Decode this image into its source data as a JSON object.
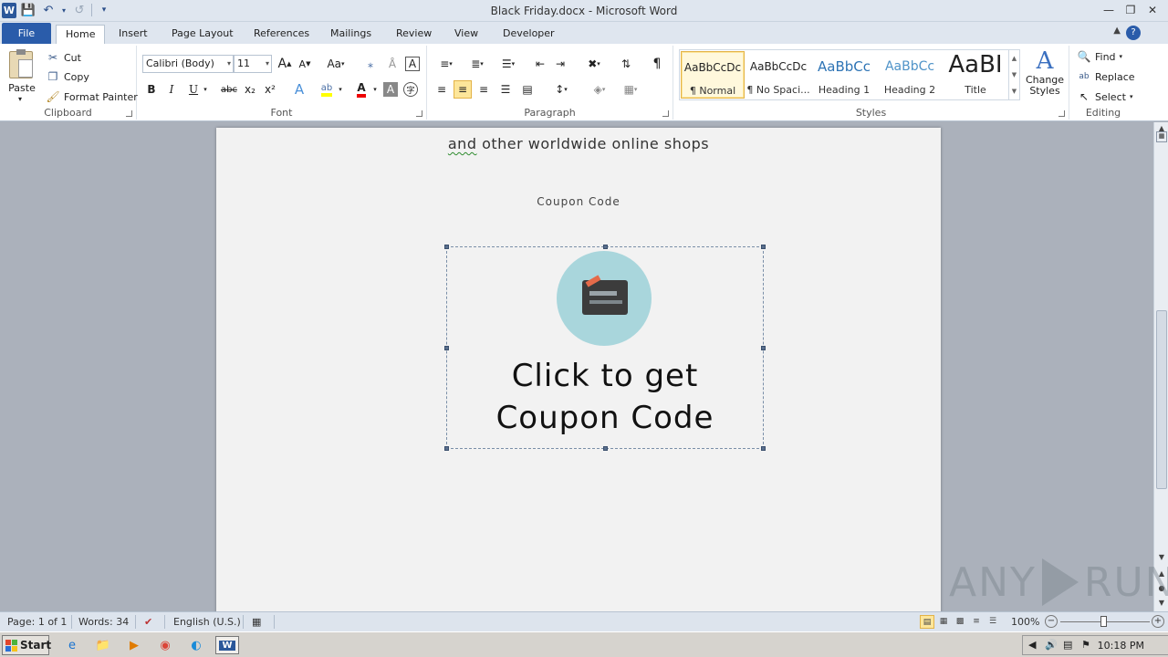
{
  "window": {
    "title": "Black Friday.docx - Microsoft Word",
    "app_icon": "W",
    "controls": [
      "minimize-icon",
      "restore-icon",
      "close-icon"
    ]
  },
  "tabs": [
    {
      "label": "File"
    },
    {
      "label": "Home"
    },
    {
      "label": "Insert"
    },
    {
      "label": "Page Layout"
    },
    {
      "label": "References"
    },
    {
      "label": "Mailings"
    },
    {
      "label": "Review"
    },
    {
      "label": "View"
    },
    {
      "label": "Developer"
    }
  ],
  "ribbon": {
    "clipboard": {
      "label": "Clipboard",
      "paste": "Paste",
      "cut": "Cut",
      "copy": "Copy",
      "format_painter": "Format Painter"
    },
    "font": {
      "label": "Font",
      "family": "Calibri (Body)",
      "size": "11",
      "bold": "B",
      "italic": "I",
      "underline": "U",
      "strike": "abc",
      "subscript": "x₂",
      "superscript": "x²",
      "change_case": "Aa",
      "grow": "A",
      "shrink": "A"
    },
    "paragraph": {
      "label": "Paragraph",
      "pilcrow": "¶"
    },
    "styles": {
      "label": "Styles",
      "items": [
        {
          "preview": "AaBbCcDc",
          "name": "¶ Normal"
        },
        {
          "preview": "AaBbCcDc",
          "name": "¶ No Spaci..."
        },
        {
          "preview": "AaBbCc",
          "name": "Heading 1"
        },
        {
          "preview": "AaBbCc",
          "name": "Heading 2"
        },
        {
          "preview": "AaBI",
          "name": "Title"
        }
      ],
      "change_styles": "Change Styles"
    },
    "editing": {
      "label": "Editing",
      "find": "Find",
      "replace": "Replace",
      "select": "Select"
    }
  },
  "document": {
    "line_before_coupon": "and other worldwide online shops",
    "squiggle_word": "and",
    "coupon_heading": "Coupon Code",
    "image_cta_line1": "Click to get",
    "image_cta_line2": "Coupon Code"
  },
  "status": {
    "page": "Page: 1 of 1",
    "words": "Words: 34",
    "language": "English (U.S.)",
    "zoom": "100%",
    "zoom_level": 1.0
  },
  "taskbar": {
    "start": "Start",
    "clock": "10:18 PM"
  },
  "watermark": {
    "text_left": "ANY",
    "text_right": "RUN"
  },
  "colors": {
    "file_tab": "#2a5caa",
    "selected_highlight": "#fde69a",
    "badge": "#a9d6dc",
    "heading_blue": "#2e74b5"
  }
}
